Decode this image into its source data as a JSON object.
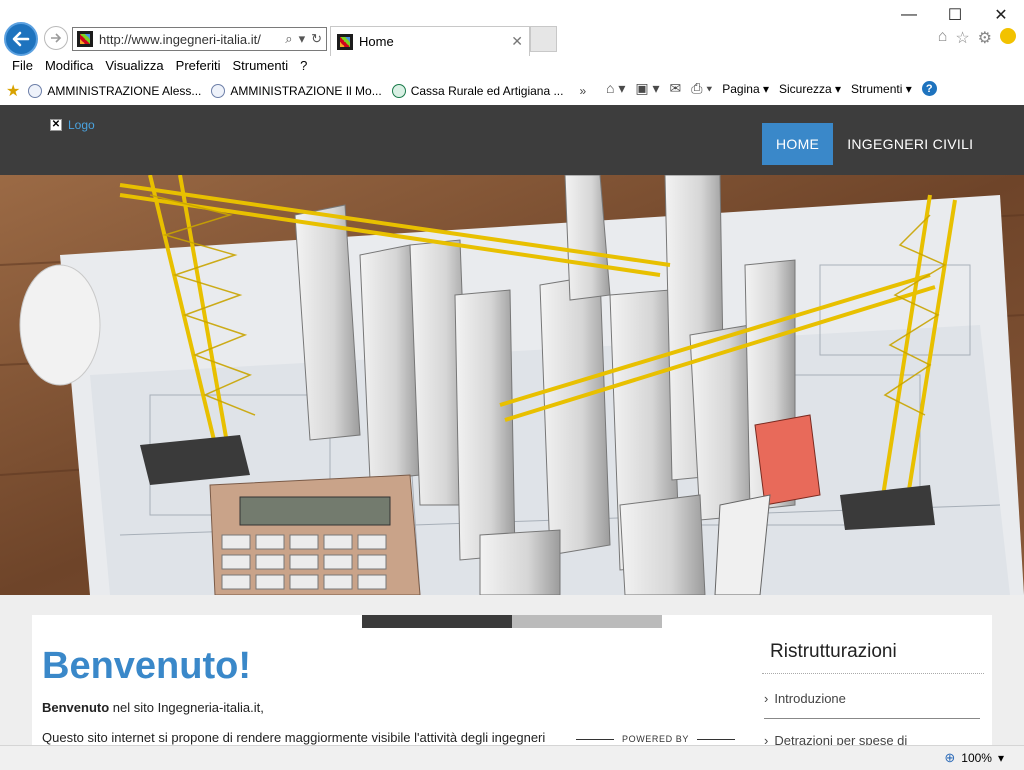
{
  "browser": {
    "url": "http://www.ingegneri-italia.it/",
    "tab_title": "Home",
    "window_controls": {
      "minimize": "—",
      "maximize": "☐",
      "close": "✕"
    },
    "menu": [
      "File",
      "Modifica",
      "Visualizza",
      "Preferiti",
      "Strumenti",
      "?"
    ],
    "favorites": [
      {
        "label": "AMMINISTRAZIONE Aless...",
        "icon": "globe-icon"
      },
      {
        "label": "AMMINISTRAZIONE Il Mo...",
        "icon": "globe-icon"
      },
      {
        "label": "Cassa Rurale ed Artigiana ...",
        "icon": "bank-icon"
      }
    ],
    "command_bar": {
      "page_label": "Pagina",
      "security_label": "Sicurezza",
      "tools_label": "Strumenti"
    },
    "zoom": "100%"
  },
  "site": {
    "logo_alt": "Logo",
    "nav": [
      {
        "label": "HOME",
        "active": true
      },
      {
        "label": "INGEGNERI CIVILI",
        "active": false
      }
    ],
    "hero_image": "construction-cranes-city-model",
    "slider_active_index": 0,
    "content": {
      "title": "Benvenuto!",
      "intro_bold": "Benvenuto",
      "intro_rest": " nel sito Ingegneria-italia.it,",
      "paragraph": "Questo sito internet si propone di rendere maggiormente visibile l'attività degli ingegneri"
    },
    "powered_by": "POWERED BY",
    "sidebar": {
      "title": "Ristrutturazioni",
      "links": [
        "Introduzione",
        "Detrazioni per spese di"
      ]
    }
  }
}
